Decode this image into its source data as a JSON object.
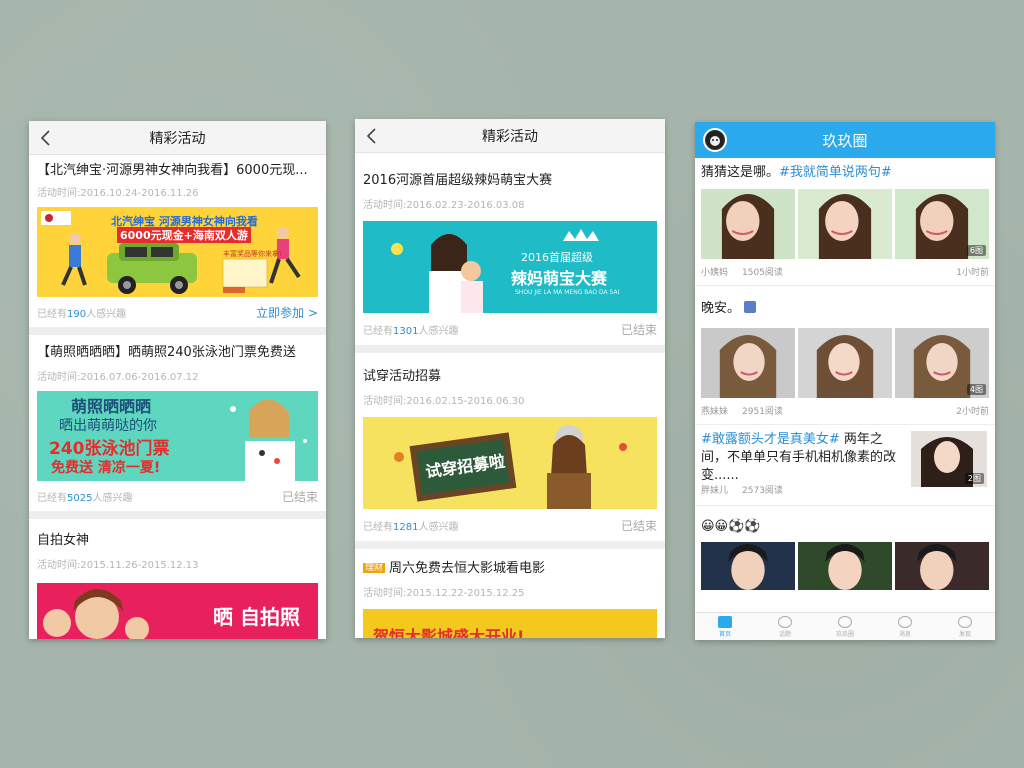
{
  "phone1": {
    "header_title": "精彩活动",
    "cards": [
      {
        "title": "【北汽绅宝·河源男神女神向我看】6000元现...",
        "time": "活动时间:2016.10.24-2016.11.26",
        "banner_main": "北汽绅宝 河源男神女神向我看",
        "banner_cash": "6000元现金+海南双人游",
        "banner_sub": "丰富奖品等你来拿!",
        "interest_prefix": "已经有",
        "interest_num": "190",
        "interest_suffix": "人感兴趣",
        "action": "立即参加 >"
      },
      {
        "title": "【萌照晒晒晒】晒萌照240张泳池门票免费送",
        "time": "活动时间:2016.07.06-2016.07.12",
        "banner_line1": "萌照晒晒晒",
        "banner_line2": "晒出萌萌哒的你",
        "banner_line3": "240张泳池门票",
        "banner_line4": "免费送 清凉一夏!",
        "interest_prefix": "已经有",
        "interest_num": "5025",
        "interest_suffix": "人感兴趣",
        "status": "已结束"
      },
      {
        "title": "自拍女神",
        "time": "活动时间:2015.11.26-2015.12.13",
        "banner_text": "晒 自拍照"
      }
    ]
  },
  "phone2": {
    "header_title": "精彩活动",
    "cards": [
      {
        "title": "2016河源首届超级辣妈萌宝大赛",
        "time": "活动时间:2016.02.23-2016.03.08",
        "banner_line1": "2016首届超级",
        "banner_line2": "辣妈萌宝大赛",
        "banner_line3": "SHOU JIE LA MA MENG BAO DA SAI",
        "interest_prefix": "已经有",
        "interest_num": "1301",
        "interest_suffix": "人感兴趣",
        "status": "已结束"
      },
      {
        "title": "试穿活动招募",
        "time": "活动时间:2016.02.15-2016.06.30",
        "banner_text": "试穿招募啦",
        "interest_prefix": "已经有",
        "interest_num": "1281",
        "interest_suffix": "人感兴趣",
        "status": "已结束"
      },
      {
        "badge": "理财",
        "title": "周六免费去恒大影城看电影",
        "time": "活动时间:2015.12.22-2015.12.25",
        "banner_text": "贺恒大影城盛大开业!"
      }
    ]
  },
  "phone3": {
    "header_title": "玖玖圈",
    "posts": [
      {
        "text": "猜猜这是哪。",
        "tag": "#我就简单说两句#",
        "author": "小姨妈",
        "reads": "1505阅读",
        "time": "1小时前",
        "count": "6图"
      },
      {
        "text": "晚安。",
        "author": "燕妹妹",
        "reads": "2951阅读",
        "time": "2小时前",
        "count": "4图"
      },
      {
        "tag": "#敢露额头才是真美女#",
        "text": " 两年之间，不单单只有手机相机像素的改变......",
        "author": "胖妹儿",
        "reads": "2573阅读",
        "count": "2图"
      },
      {
        "text": "😀😀⚽⚽"
      }
    ],
    "tabs": [
      "首页",
      "话题",
      "玖玖圈",
      "消息",
      "发现"
    ]
  },
  "colors": {
    "accent": "#2aa9ec",
    "link": "#2a8fd6",
    "background": "#a6b5ab"
  }
}
